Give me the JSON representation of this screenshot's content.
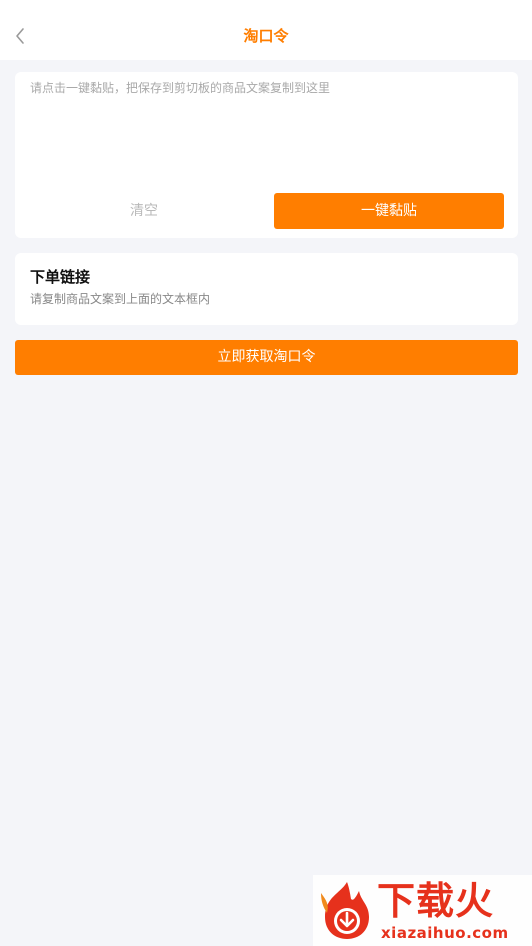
{
  "header": {
    "title": "淘口令",
    "back_icon": "chevron-left-icon"
  },
  "paste_card": {
    "placeholder": "请点击一键黏贴，把保存到剪切板的商品文案复制到这里",
    "value": "",
    "clear_label": "清空",
    "paste_label": "一键黏贴"
  },
  "link_card": {
    "title": "下单链接",
    "hint": "请复制商品文案到上面的文本框内"
  },
  "submit": {
    "label": "立即获取淘口令"
  },
  "watermark": {
    "brand": "下载火",
    "url": "xiazaihuo.com"
  },
  "colors": {
    "accent": "#ff7e00",
    "background": "#f4f5f9",
    "card": "#ffffff",
    "placeholder": "#a9a9a9",
    "watermark": "#e6311c"
  }
}
